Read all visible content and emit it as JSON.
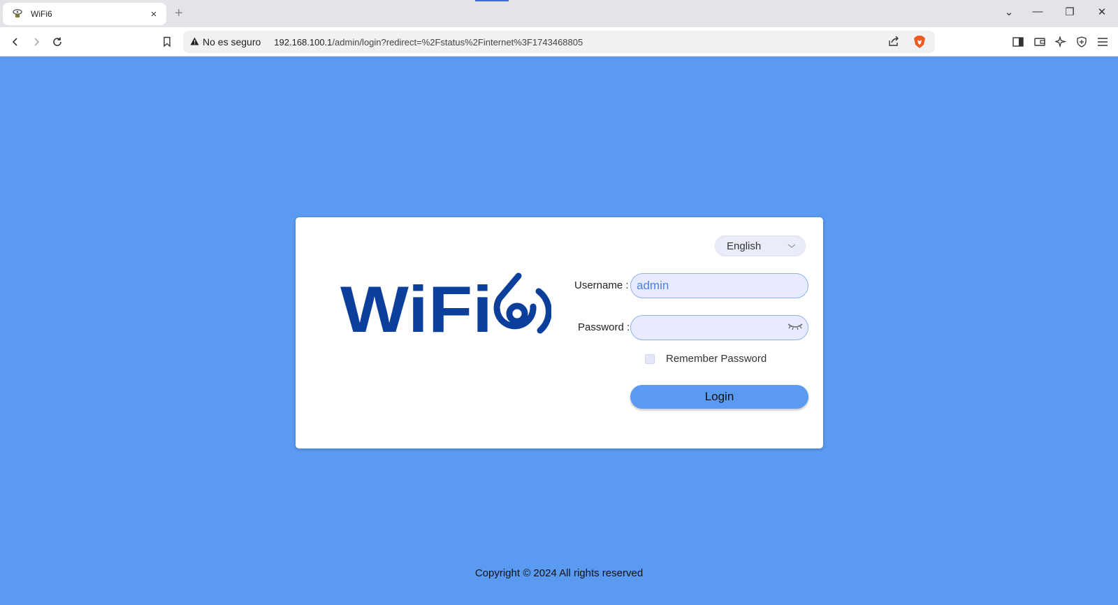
{
  "browser": {
    "tab_title": "WiFi6",
    "tab_close": "×",
    "new_tab": "+",
    "security_label": "No es seguro",
    "url_host": "192.168.100.1",
    "url_path": "/admin/login?redirect=%2Fstatus%2Finternet%3F1743468805",
    "window_controls": {
      "tab_search": "⌄",
      "minimize": "—",
      "restore": "❐",
      "close": "✕"
    }
  },
  "logo": {
    "text": "WiFi",
    "digit": "6",
    "color": "#0c3f9c"
  },
  "login": {
    "language": "English",
    "username_label": "Username :",
    "username_value": "admin",
    "password_label": "Password :",
    "password_value": "",
    "remember_label": "Remember Password",
    "remember_checked": false,
    "login_button": "Login"
  },
  "footer": {
    "copyright": "Copyright © 2024 All rights reserved"
  },
  "colors": {
    "page_background": "#5a9af0",
    "accent": "#5a9af0",
    "input_background": "#e8ebff",
    "logo": "#0c3f9c"
  }
}
